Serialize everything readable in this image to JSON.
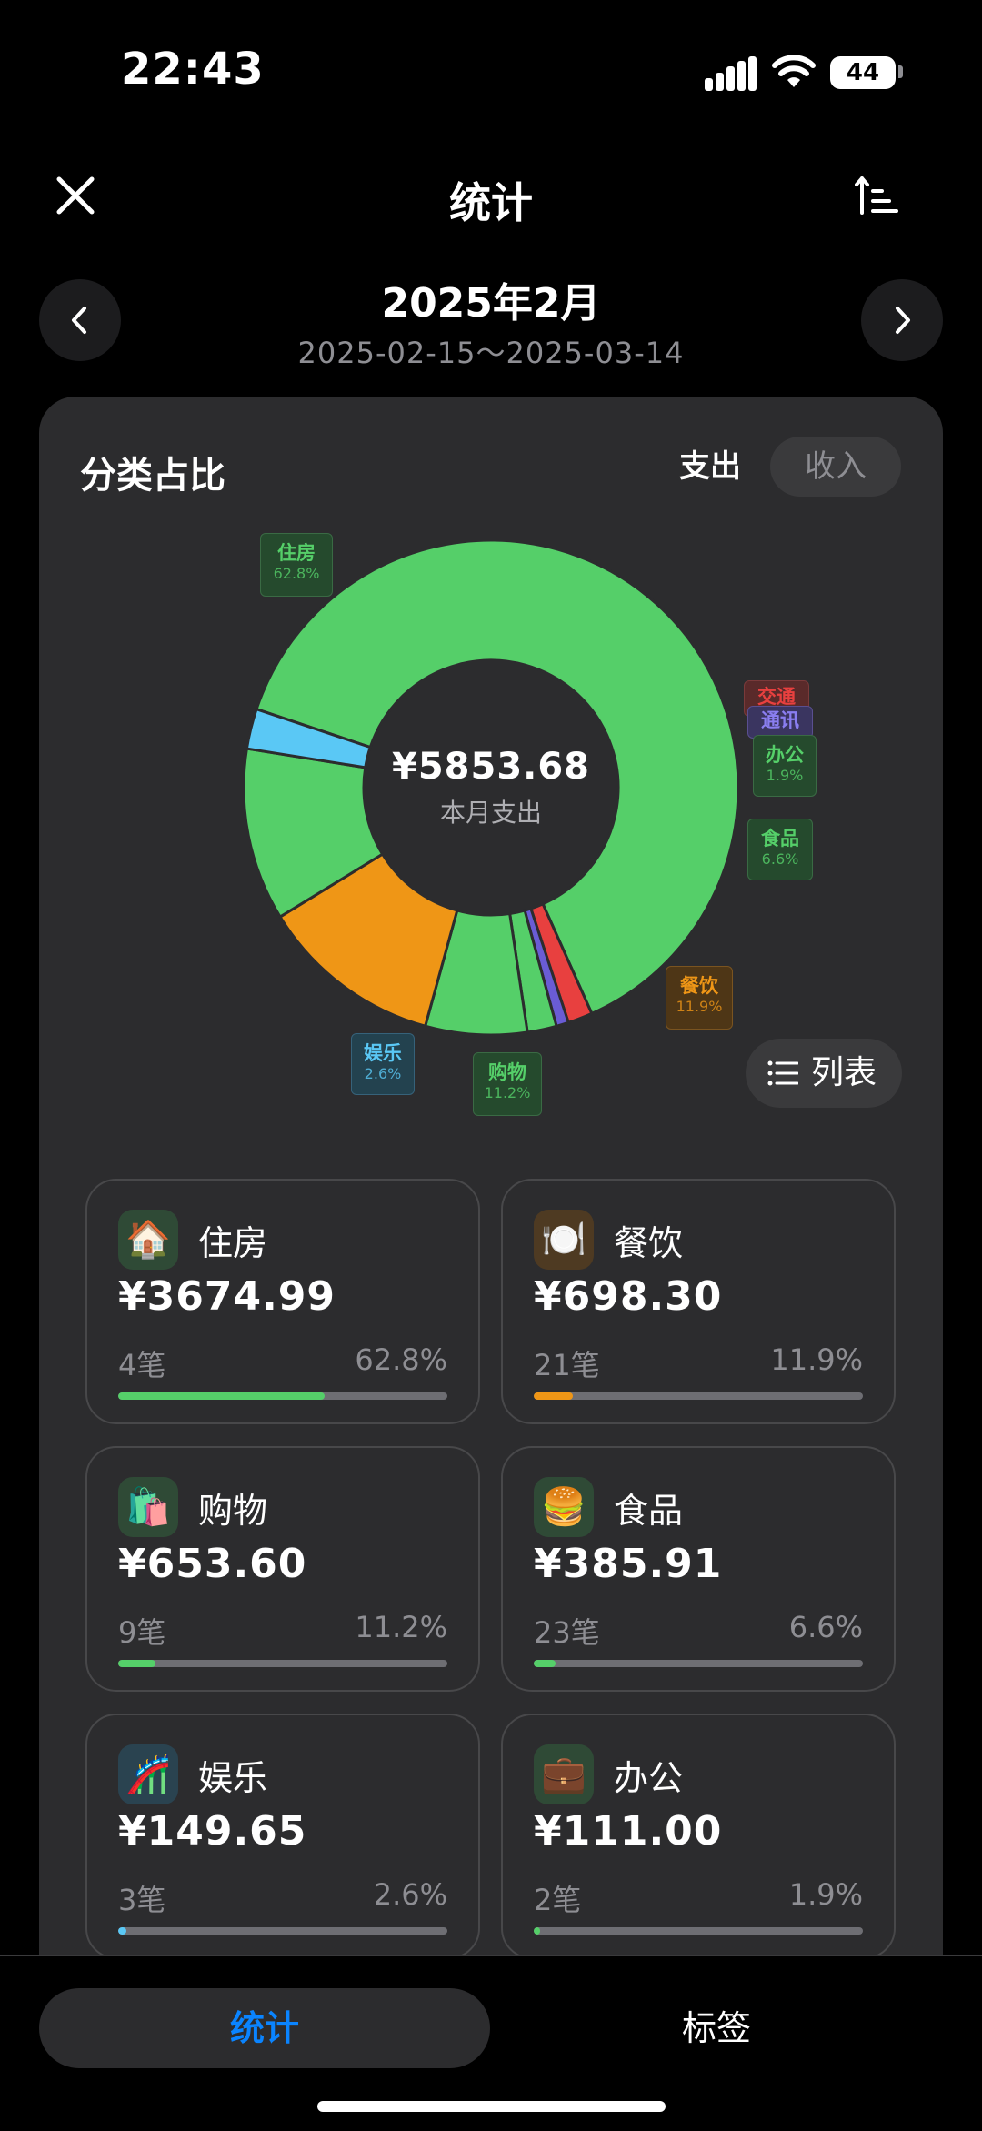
{
  "status_bar": {
    "time": "22:43",
    "battery": "44"
  },
  "header": {
    "title": "统计"
  },
  "period": {
    "month": "2025年2月",
    "range": "2025-02-15～2025-03-14"
  },
  "section": {
    "title": "分类占比",
    "tabs": {
      "expense": "支出",
      "income": "收入",
      "active": "expense"
    }
  },
  "donut": {
    "total": "¥5853.68",
    "caption": "本月支出"
  },
  "chart_data": {
    "type": "pie",
    "slices": [
      {
        "name": "住房",
        "percent": 62.8,
        "color": "#55cf69"
      },
      {
        "name": "交通",
        "percent": 1.6,
        "color": "#e8403f"
      },
      {
        "name": "通讯",
        "percent": 0.8,
        "color": "#6a5cd4"
      },
      {
        "name": "办公",
        "percent": 1.9,
        "color": "#55cf69"
      },
      {
        "name": "食品",
        "percent": 6.6,
        "color": "#55cf69"
      },
      {
        "name": "餐饮",
        "percent": 11.9,
        "color": "#ef9616"
      },
      {
        "name": "购物",
        "percent": 11.2,
        "color": "#55cf69"
      },
      {
        "name": "娱乐",
        "percent": 2.6,
        "color": "#5ac8f5"
      }
    ]
  },
  "labels": {
    "housing": {
      "name": "住房",
      "pct": "62.8%"
    },
    "transport": {
      "name": "交通"
    },
    "telecom": {
      "name": "通讯"
    },
    "office": {
      "name": "办公",
      "pct": "1.9%"
    },
    "food": {
      "name": "食品",
      "pct": "6.6%"
    },
    "dining": {
      "name": "餐饮",
      "pct": "11.9%"
    },
    "shopping": {
      "name": "购物",
      "pct": "11.2%"
    },
    "entertainment": {
      "name": "娱乐",
      "pct": "2.6%"
    }
  },
  "list_button": "列表",
  "categories": [
    {
      "icon": "house",
      "emoji": "🏠",
      "name": "住房",
      "amount": "¥3674.99",
      "count": "4笔",
      "pct": "62.8%",
      "fraction": 0.628,
      "color": "#55cf69"
    },
    {
      "icon": "plate",
      "emoji": "🍽️",
      "name": "餐饮",
      "amount": "¥698.30",
      "count": "21笔",
      "pct": "11.9%",
      "fraction": 0.119,
      "color": "#ef9616"
    },
    {
      "icon": "shopping-bags",
      "emoji": "🛍️",
      "name": "购物",
      "amount": "¥653.60",
      "count": "9笔",
      "pct": "11.2%",
      "fraction": 0.112,
      "color": "#55cf69"
    },
    {
      "icon": "burger",
      "emoji": "🍔",
      "name": "食品",
      "amount": "¥385.91",
      "count": "23笔",
      "pct": "6.6%",
      "fraction": 0.066,
      "color": "#55cf69"
    },
    {
      "icon": "roller-coaster",
      "emoji": "🎢",
      "name": "娱乐",
      "amount": "¥149.65",
      "count": "3笔",
      "pct": "2.6%",
      "fraction": 0.026,
      "color": "#5ac8f5"
    },
    {
      "icon": "briefcase",
      "emoji": "💼",
      "name": "办公",
      "amount": "¥111.00",
      "count": "2笔",
      "pct": "1.9%",
      "fraction": 0.019,
      "color": "#55cf69"
    }
  ],
  "bottom_tabs": {
    "stats": "统计",
    "tags": "标签",
    "active": "stats"
  }
}
